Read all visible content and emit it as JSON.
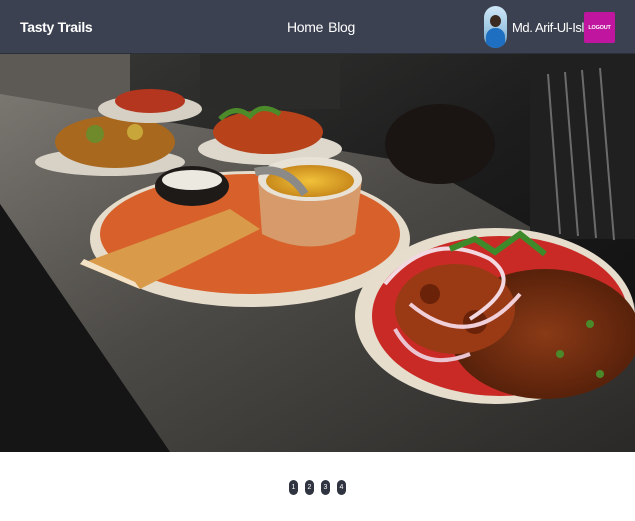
{
  "navbar": {
    "brand": "Tasty Trails",
    "links": [
      {
        "label": "Home"
      },
      {
        "label": "Blog"
      }
    ],
    "user": {
      "name": "Md. Arif-Ul-Islam"
    },
    "logout_label": "LOGOUT",
    "colors": {
      "background": "#3b4150",
      "logout": "#c0169f"
    }
  },
  "hero": {
    "icon": "food-photo"
  },
  "pagination": {
    "pages": [
      "1",
      "2",
      "3",
      "4"
    ]
  }
}
